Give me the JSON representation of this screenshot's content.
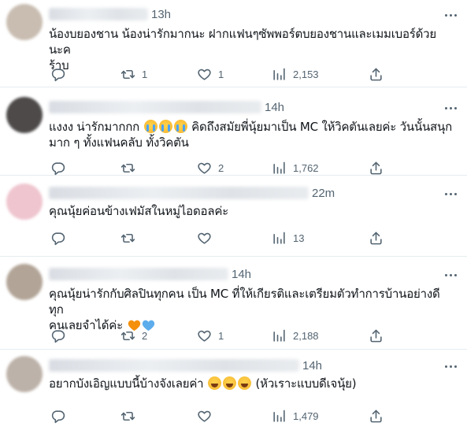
{
  "replies": [
    {
      "time": "13h",
      "text": "น้องบยองชาน น้องน่ารักมากนะ ฝากแฟนๆซัพพอร์ตบยองชานและเมมเบอร์ด้วยนะค\nร้าบ",
      "emojis_after": [],
      "reply_count": "",
      "retweets": "1",
      "likes": "1",
      "views": "2,153",
      "avatar_color": "#c9bdb1"
    },
    {
      "time": "14h",
      "text_before": "แงงง น่ารักมากกก ",
      "emojis_mid": [
        "loudly-crying-face",
        "loudly-crying-face",
        "loudly-crying-face"
      ],
      "text_after": " คิดถึงสมัยพี่นุ้ยมาเป็น MC ให้วิคตันเลยค่ะ วันนั้นสนุก\nมาก ๆ ทั้งแฟนคลับ ทั้งวิคตัน",
      "reply_count": "",
      "retweets": "",
      "likes": "2",
      "views": "1,762",
      "avatar_color": "#4e4a4a"
    },
    {
      "time": "22m",
      "text": "คุณนุ้ยค่อนข้างเฟมัสในหมู่ไอดอลค่ะ",
      "reply_count": "",
      "retweets": "",
      "likes": "",
      "views": "13",
      "avatar_color": "#efc5cf"
    },
    {
      "time": "14h",
      "text": "คุณนุ้ยน่ารักกับศิลปินทุกคน เป็น MC ที่ให้เกียรติและเตรียมตัวทำการบ้านอย่างดี ทุก\nคนเลยจำได้ค่ะ ",
      "hearts": [
        "orange-heart",
        "blue-heart"
      ],
      "reply_count": "",
      "retweets": "2",
      "likes": "1",
      "views": "2,188",
      "avatar_color": "#b2a497"
    },
    {
      "time": "14h",
      "text_before": "อยากบังเอิญแบบนี้บ้างจังเลยค่า ",
      "emojis_mid": [
        "grinning-squinting-face",
        "grinning-squinting-face",
        "grinning-squinting-face"
      ],
      "text_after": " (หัวเราะแบบดีเจนุ้ย)",
      "reply_count": "",
      "retweets": "",
      "likes": "",
      "views": "1,479",
      "avatar_color": "#bdb2a9"
    }
  ],
  "colors": {
    "text": "#0f1419",
    "muted": "#536471",
    "divider": "#e6ecf0",
    "orange_heart": "#f4900c",
    "blue_heart": "#5dadec"
  }
}
